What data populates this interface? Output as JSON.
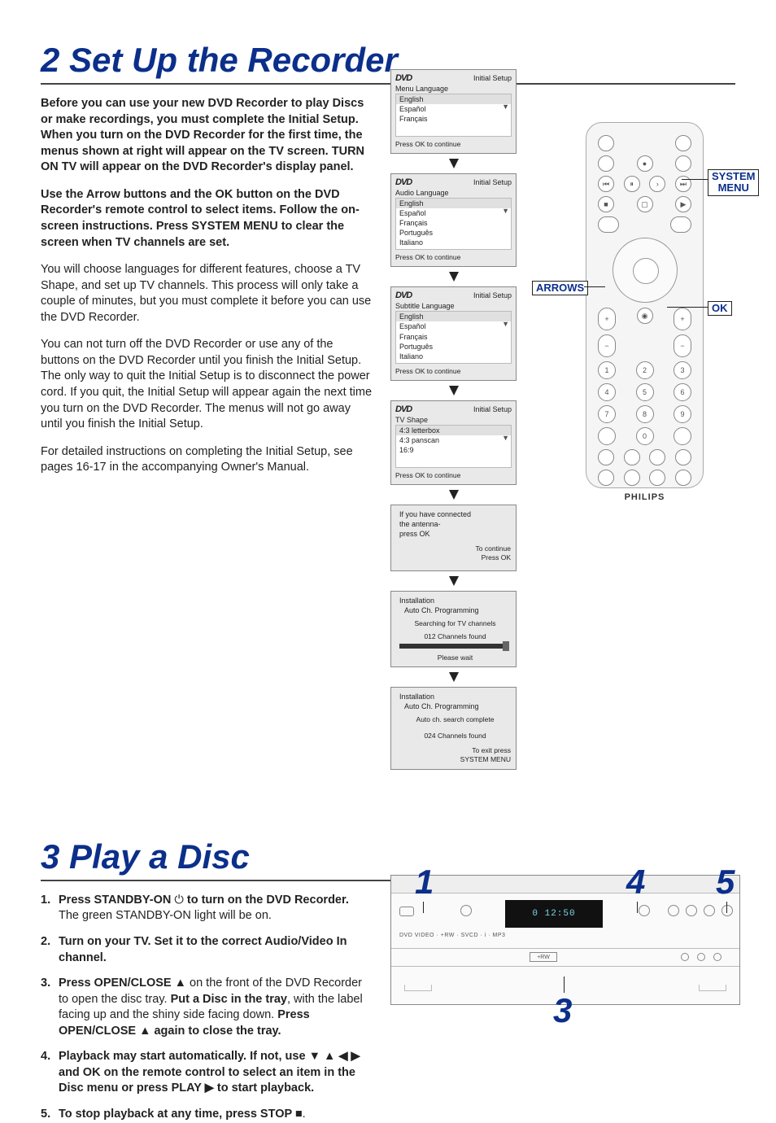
{
  "section2": {
    "title": "2 Set Up the Recorder",
    "intro": "Before you can use your new DVD Recorder to play Discs or make recordings, you must complete the Initial Setup. When you turn on the DVD Recorder for the first time, the menus shown at right will appear on the TV screen.  TURN ON TV will appear on the DVD Recorder's display panel.",
    "instr": "Use the Arrow buttons and the OK button on the DVD Recorder's remote control to select items. Follow the on-screen instructions. Press SYSTEM MENU to clear the screen when TV channels are set.",
    "p1": "You will choose languages for different features, choose a TV Shape, and set up TV channels.  This process will only take a couple of minutes, but you must complete it before you can use the DVD Recorder.",
    "p2": "You can not turn off the DVD Recorder or use any of the buttons on the DVD Recorder until you finish the Initial Setup. The only way to quit the Initial Setup is to disconnect the power cord. If you quit, the Initial Setup will appear again the next time you turn on the DVD Recorder. The menus will not go away until you finish the Initial Setup.",
    "p3": "For detailed instructions on completing the Initial Setup, see pages 16-17 in the accompanying Owner's Manual."
  },
  "osd": {
    "dvd_logo": "DVD",
    "initial_setup": "Initial Setup",
    "press_ok": "Press OK to continue",
    "menu1": {
      "title": "Menu Language",
      "items": [
        "English",
        "Español",
        "Français"
      ]
    },
    "menu2": {
      "title": "Audio Language",
      "items": [
        "English",
        "Español",
        "Français",
        "Português",
        "Italiano"
      ]
    },
    "menu3": {
      "title": "Subtitle Language",
      "items": [
        "English",
        "Español",
        "Français",
        "Português",
        "Italiano"
      ]
    },
    "menu4": {
      "title": "TV Shape",
      "items": [
        "4:3 letterbox",
        "4:3 panscan",
        "16:9"
      ]
    },
    "menu5": {
      "l1": "If you have connected",
      "l2": "the antenna-",
      "l3": "press OK",
      "r1": "To continue",
      "r2": "Press OK"
    },
    "menu6": {
      "h": "Installation",
      "t": "Auto Ch. Programming",
      "l1": "Searching for TV channels",
      "l2": "012 Channels found",
      "l3": "Please wait"
    },
    "menu7": {
      "h": "Installation",
      "t": "Auto Ch. Programming",
      "l1": "Auto ch. search complete",
      "l2": "024 Channels found",
      "r1": "To exit press",
      "r2": "SYSTEM MENU"
    }
  },
  "remote": {
    "brand": "PHILIPS",
    "callouts": {
      "system_menu_l1": "SYSTEM",
      "system_menu_l2": "MENU",
      "arrows": "ARROWS",
      "ok": "OK"
    }
  },
  "section3": {
    "title": "3 Play a Disc",
    "steps": {
      "s1_b": "Press STANDBY-ON ",
      "s1_sym": "⏻",
      "s1_b2": " to turn on the DVD Recorder.",
      "s1_r": " The green STANDBY-ON light will be on.",
      "s2_b": "Turn on your TV. Set it to the correct Audio/Video In channel.",
      "s3_b": "Press OPEN/CLOSE ",
      "s3_sym": "▲",
      "s3_r1": " on the front of the DVD Recorder to open the disc tray. ",
      "s3_b2": "Put a Disc in the tray",
      "s3_r2": ", with the label facing up and the shiny side facing down. ",
      "s3_b3": "Press OPEN/CLOSE ",
      "s3_b3s": "▲",
      "s3_b3e": " again to close the tray.",
      "s4_b1": "Playback may start automatically. If not, use ▼ ▲ ◀ ▶  and OK on the remote control to select an item in the Disc menu or press PLAY ▶ to start playback.",
      "s5_b": "To stop playback at any time, press STOP ",
      "s5_sym": "■",
      "s5_r": "."
    },
    "nums": {
      "n1": "1",
      "n4": "4",
      "n5": "5",
      "n3": "3"
    }
  },
  "device": {
    "display": "0 12:50",
    "tray_label": "+RW"
  }
}
